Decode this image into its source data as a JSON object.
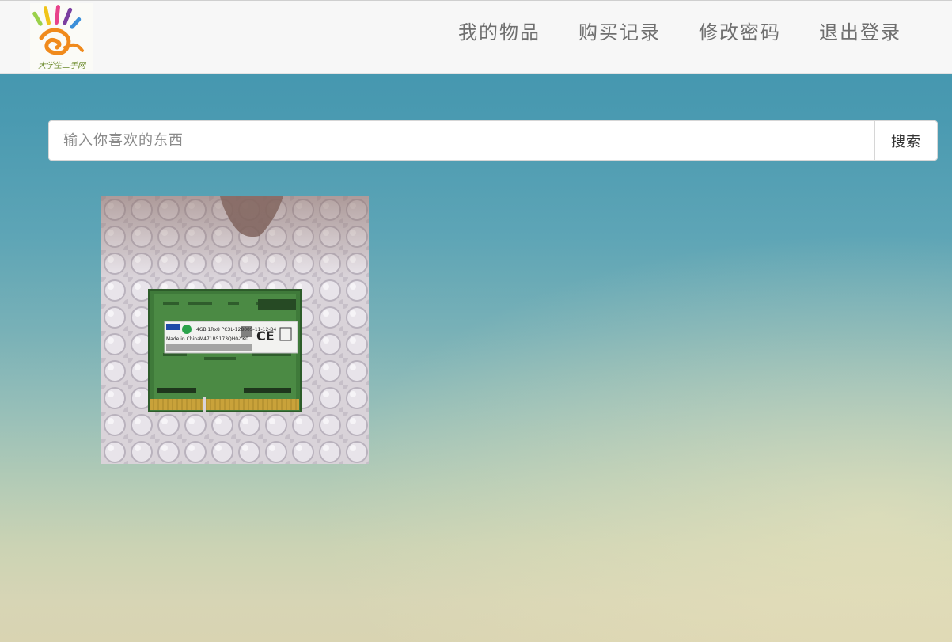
{
  "header": {
    "logo_icon": "handprint-logo-icon",
    "logo_text": "大学生二手网",
    "nav": [
      {
        "label": "我的物品"
      },
      {
        "label": "购买记录"
      },
      {
        "label": "修改密码"
      },
      {
        "label": "退出登录"
      }
    ]
  },
  "search": {
    "placeholder": "输入你喜欢的东西",
    "value": "",
    "button_label": "搜索"
  },
  "items": [
    {
      "image_icon": "ram-module-photo",
      "label_lines": [
        "4GB 1Rx8 PC3L-12800S-11-12-B4",
        "M471B5173QH0-YK0"
      ],
      "origin": "Made in China"
    }
  ],
  "colors": {
    "navbar_bg": "#f7f7f7",
    "nav_text": "#6f6f6f",
    "bg_top": "#3f93ad",
    "bg_bottom": "#d9d4b2"
  }
}
